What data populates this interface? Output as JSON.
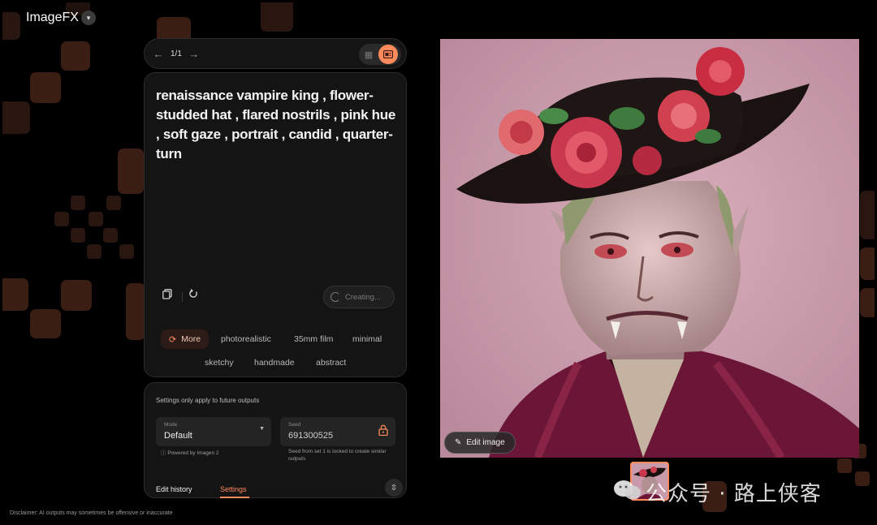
{
  "app": {
    "title": "ImageFX"
  },
  "nav": {
    "count": "1/1",
    "prev_icon": "arrow-left-icon",
    "next_icon": "arrow-right-icon"
  },
  "prompt": {
    "text": "renaissance vampire king , flower-studded hat , flared nostrils , pink hue , soft gaze , portrait , candid , quarter-turn",
    "creating_label": "Creating..."
  },
  "chips": {
    "more": "More",
    "row1": [
      "photorealistic",
      "35mm film",
      "minimal"
    ],
    "row2": [
      "sketchy",
      "handmade",
      "abstract"
    ]
  },
  "settings": {
    "note": "Settings only apply to future outputs",
    "mode_label": "Mode",
    "mode_value": "Default",
    "powered": "Powered by Imagen 2",
    "seed_label": "Seed",
    "seed_value": "691300525",
    "seed_note": "Seed from set 1 is locked to create similar outputs"
  },
  "tabs": {
    "history": "Edit history",
    "settings": "Settings"
  },
  "image": {
    "edit_label": "Edit image"
  },
  "disclaimer": "Disclaimer: AI outputs may sometimes be offensive or inaccurate",
  "watermark": "公众号 · 路上侠客",
  "colors": {
    "accent": "#ff8a5c",
    "panel": "#141414",
    "background": "#000000"
  }
}
